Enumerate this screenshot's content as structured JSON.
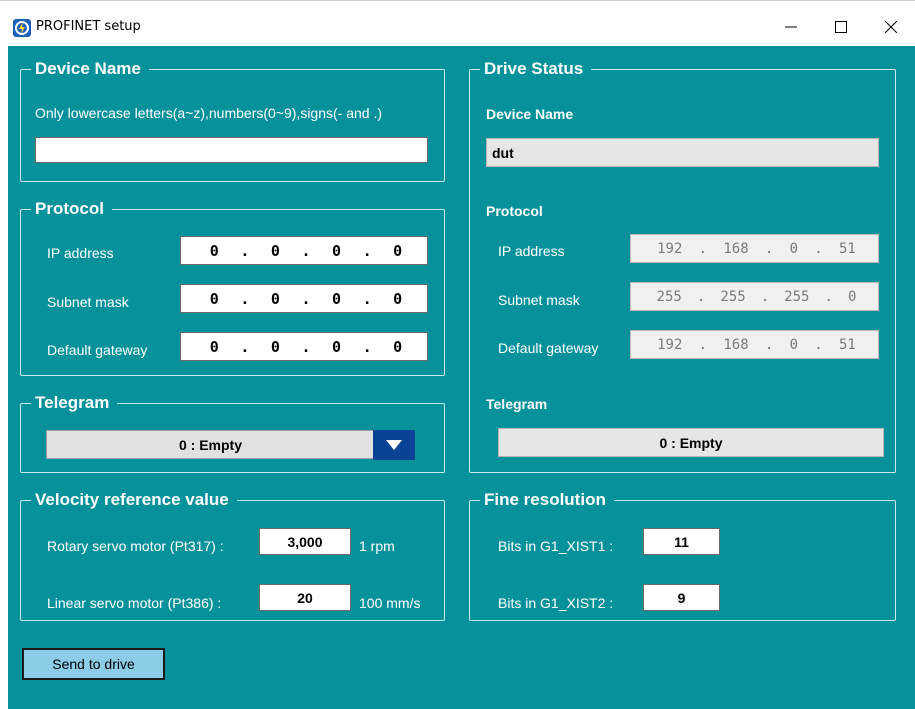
{
  "window": {
    "title": "PROFINET setup",
    "minimize_glyph": "—",
    "maximize_glyph": "☐",
    "close_glyph": "✕"
  },
  "device_name": {
    "legend": "Device Name",
    "hint": "Only lowercase letters(a~z),numbers(0~9),signs(- and .)",
    "value": ""
  },
  "protocol": {
    "legend": "Protocol",
    "ip_label": "IP address",
    "ip": [
      "0",
      "0",
      "0",
      "0"
    ],
    "subnet_label": "Subnet mask",
    "subnet": [
      "0",
      "0",
      "0",
      "0"
    ],
    "gateway_label": "Default gateway",
    "gateway": [
      "0",
      "0",
      "0",
      "0"
    ]
  },
  "telegram": {
    "legend": "Telegram",
    "selected": "0  : Empty"
  },
  "velocity": {
    "legend": "Velocity reference value",
    "rotary_label": "Rotary servo motor (Pt317) :",
    "rotary_value": "3,000",
    "rotary_unit": "1 rpm",
    "linear_label": "Linear servo motor (Pt386) :",
    "linear_value": "20",
    "linear_unit": "100 mm/s"
  },
  "drive_status": {
    "legend": "Drive Status",
    "device_name_label": "Device Name",
    "device_name_value": "dut",
    "protocol_label": "Protocol",
    "ip_label": "IP address",
    "ip": [
      "192",
      "168",
      "0",
      "51"
    ],
    "subnet_label": "Subnet mask",
    "subnet": [
      "255",
      "255",
      "255",
      "0"
    ],
    "gateway_label": "Default gateway",
    "gateway": [
      "192",
      "168",
      "0",
      "51"
    ],
    "telegram_label": "Telegram",
    "telegram_value": "0  : Empty"
  },
  "fine_resolution": {
    "legend": "Fine resolution",
    "xist1_label": "Bits in G1_XIST1 :",
    "xist1_value": "11",
    "xist2_label": "Bits in G1_XIST2 :",
    "xist2_value": "9"
  },
  "send_button_label": "Send to drive",
  "ip_separator": ".",
  "colors": {
    "background": "#07929b",
    "dropdown_arrow": "#0a4396",
    "send_button": "#8bcde6"
  }
}
